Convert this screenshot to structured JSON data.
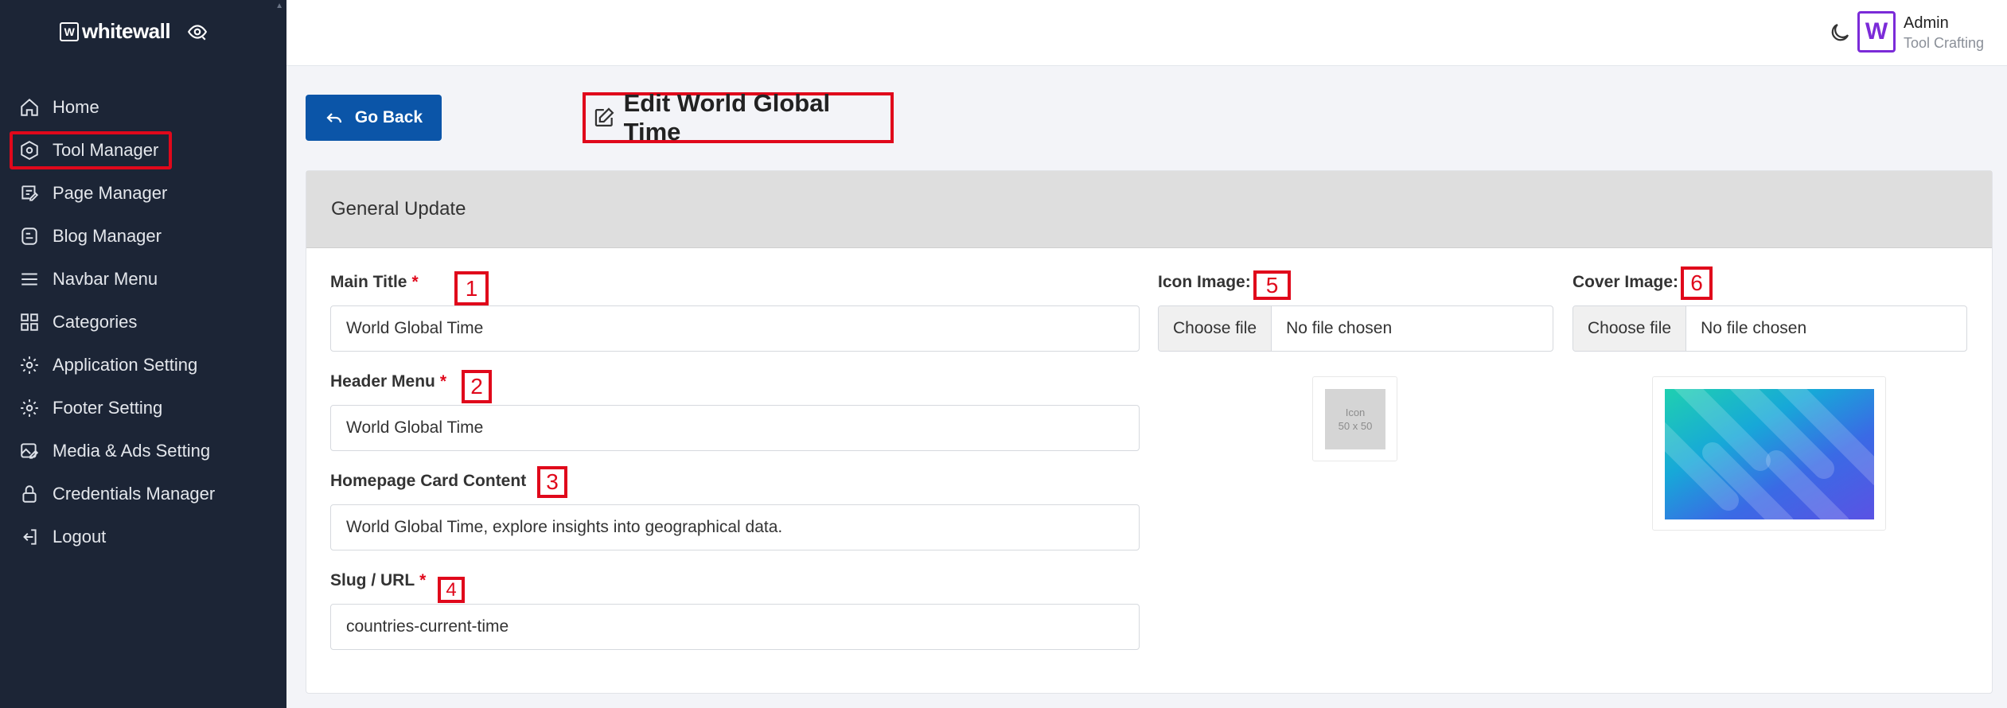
{
  "sidebar": {
    "brand": "whitewall",
    "items": [
      {
        "label": "Home",
        "icon": "home-icon"
      },
      {
        "label": "Tool Manager",
        "icon": "hexagon-cog-icon"
      },
      {
        "label": "Page Manager",
        "icon": "page-edit-icon"
      },
      {
        "label": "Blog Manager",
        "icon": "blog-icon"
      },
      {
        "label": "Navbar Menu",
        "icon": "menu-icon"
      },
      {
        "label": "Categories",
        "icon": "grid-icon"
      },
      {
        "label": "Application Setting",
        "icon": "gear-icon"
      },
      {
        "label": "Footer Setting",
        "icon": "gear-icon"
      },
      {
        "label": "Media & Ads Setting",
        "icon": "image-edit-icon"
      },
      {
        "label": "Credentials Manager",
        "icon": "lock-icon"
      },
      {
        "label": "Logout",
        "icon": "logout-icon"
      }
    ]
  },
  "header": {
    "user_name": "Admin",
    "user_role": "Tool Crafting",
    "avatar_letter": "W"
  },
  "page": {
    "back_label": "Go Back",
    "title": "Edit World Global Time"
  },
  "form": {
    "section_title": "General Update",
    "main_title_label": "Main Title",
    "main_title_value": "World Global Time",
    "header_menu_label": "Header Menu",
    "header_menu_value": "World Global Time",
    "card_content_label": "Homepage Card Content",
    "card_content_value": "World Global Time, explore insights into geographical data.",
    "slug_label": "Slug / URL",
    "slug_value": "countries-current-time",
    "required_mark": "*",
    "icon_image_label": "Icon Image:",
    "cover_image_label": "Cover Image:",
    "choose_file": "Choose file",
    "no_file": "No file chosen",
    "icon_placeholder_line1": "Icon",
    "icon_placeholder_line2": "50 x 50"
  },
  "annotations": [
    "1",
    "2",
    "3",
    "4",
    "5",
    "6"
  ],
  "colors": {
    "sidebar_bg": "#1c2536",
    "primary_button": "#0b55a8",
    "highlight_red": "#e0081b",
    "avatar_purple": "#7b2bd8"
  }
}
